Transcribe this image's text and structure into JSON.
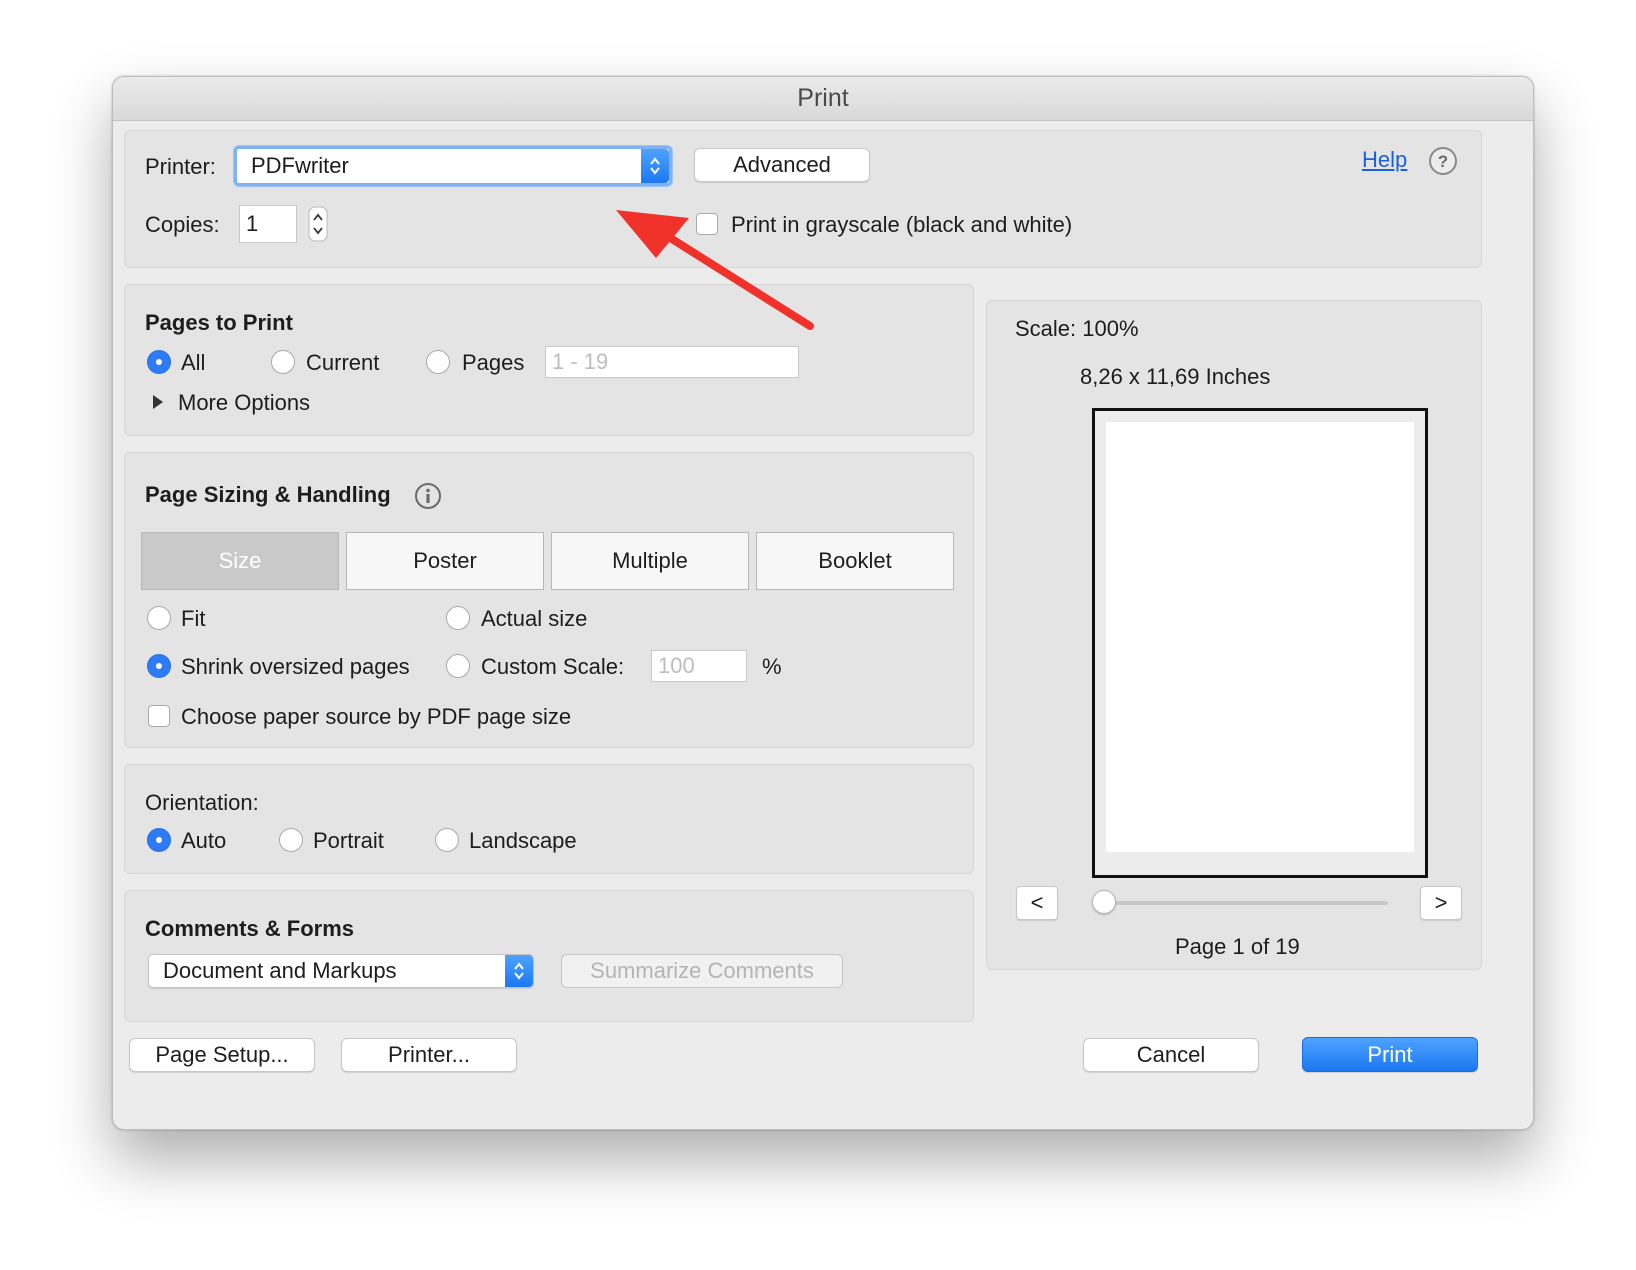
{
  "window": {
    "title": "Print"
  },
  "printer": {
    "label": "Printer:",
    "selected": "PDFwriter",
    "advanced_label": "Advanced",
    "help_label": "Help",
    "copies_label": "Copies:",
    "copies_value": "1",
    "grayscale_label": "Print in grayscale (black and white)",
    "grayscale_checked": false
  },
  "pages_to_print": {
    "title": "Pages to Print",
    "options": [
      "All",
      "Current",
      "Pages"
    ],
    "selected": "All",
    "range_placeholder": "1 - 19",
    "more_options_label": "More Options"
  },
  "page_sizing": {
    "title": "Page Sizing & Handling",
    "tabs": [
      "Size",
      "Poster",
      "Multiple",
      "Booklet"
    ],
    "active_tab": "Size",
    "fit_label": "Fit",
    "actual_size_label": "Actual size",
    "shrink_label": "Shrink oversized pages",
    "custom_scale_label": "Custom Scale:",
    "custom_scale_value": "100",
    "percent_label": "%",
    "selected": "Shrink oversized pages",
    "paper_source_label": "Choose paper source by PDF page size",
    "paper_source_checked": false
  },
  "orientation": {
    "title": "Orientation:",
    "options": [
      "Auto",
      "Portrait",
      "Landscape"
    ],
    "selected": "Auto"
  },
  "comments_forms": {
    "title": "Comments & Forms",
    "selected": "Document and Markups",
    "summarize_label": "Summarize Comments"
  },
  "preview": {
    "scale_text": "Scale: 100%",
    "size_text": "8,26 x 11,69 Inches",
    "prev_label": "<",
    "next_label": ">",
    "page_text": "Page 1 of 19",
    "slider_fraction": 0
  },
  "footer": {
    "page_setup_label": "Page Setup...",
    "printer_label": "Printer...",
    "cancel_label": "Cancel",
    "print_label": "Print"
  },
  "colors": {
    "accent": "#2f7bf6",
    "annotation_arrow": "#f0322b"
  }
}
